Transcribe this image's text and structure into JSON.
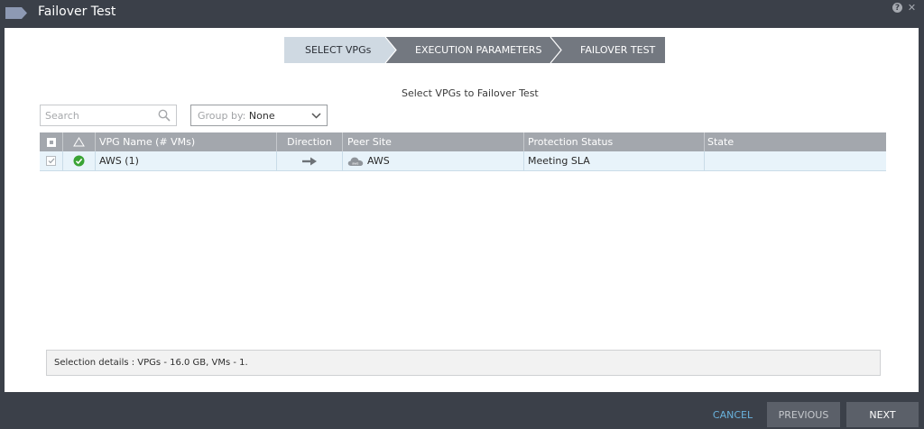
{
  "window": {
    "title": "Failover Test",
    "help_icon": "?",
    "close_icon": "✕"
  },
  "wizard": {
    "steps": [
      {
        "label": "SELECT VPGs",
        "active": true
      },
      {
        "label": "EXECUTION PARAMETERS",
        "active": false
      },
      {
        "label": "FAILOVER TEST",
        "active": false
      }
    ]
  },
  "subtitle": "Select VPGs to Failover Test",
  "search": {
    "placeholder": "Search"
  },
  "group_by": {
    "label": "Group by:",
    "value": "None"
  },
  "table": {
    "columns": [
      "VPG Name (# VMs)",
      "Direction",
      "Peer Site",
      "Protection Status",
      "State"
    ],
    "rows": [
      {
        "selected": true,
        "status_icon": "check-circle",
        "vpg_name": "AWS (1)",
        "direction": "right-arrow",
        "peer_site_icon": "aws-cloud",
        "peer_site": "AWS",
        "protection_status": "Meeting SLA",
        "state": ""
      }
    ]
  },
  "selection_details": "Selection details :  VPGs  -  16.0 GB, VMs  -  1.",
  "footer": {
    "cancel": "CANCEL",
    "previous": "PREVIOUS",
    "next": "NEXT"
  },
  "colors": {
    "chrome": "#3b4049",
    "active_step": "#cfd9e2",
    "inactive_step": "#737880",
    "header": "#a3a7ad",
    "row_selected": "#e8f3fa",
    "status_ok": "#3aa335",
    "link": "#69b2dc"
  }
}
